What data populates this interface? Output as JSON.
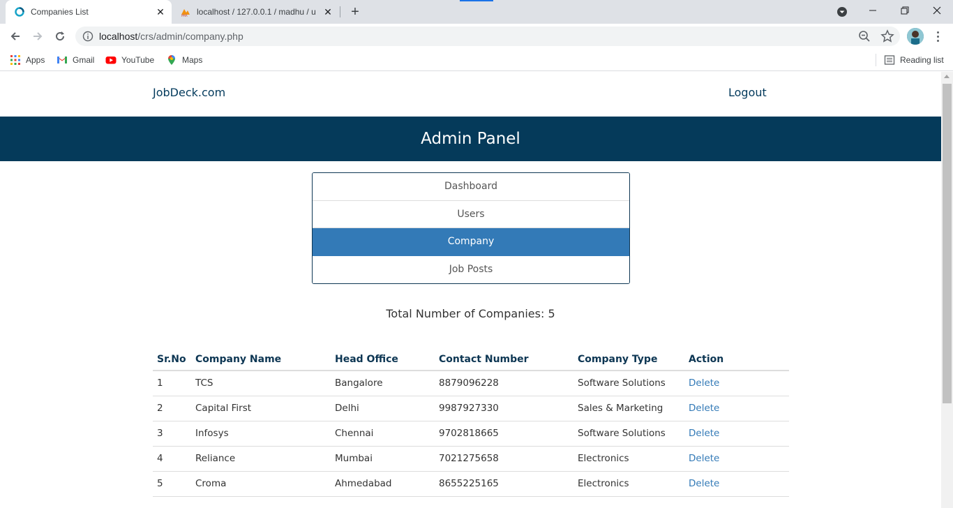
{
  "browser": {
    "tabs": [
      {
        "title": "Companies List",
        "active": true
      },
      {
        "title": "localhost / 127.0.0.1 / madhu / u",
        "active": false
      }
    ],
    "url_host": "localhost",
    "url_path": "/crs/admin/company.php",
    "bookmarks": [
      {
        "label": "Apps",
        "icon": "apps-grid-icon"
      },
      {
        "label": "Gmail",
        "icon": "gmail-icon"
      },
      {
        "label": "YouTube",
        "icon": "youtube-icon"
      },
      {
        "label": "Maps",
        "icon": "maps-icon"
      }
    ],
    "reading_list": "Reading list"
  },
  "header": {
    "brand": "JobDeck.com",
    "logout": "Logout",
    "banner_title": "Admin Panel"
  },
  "menu": {
    "items": [
      {
        "label": "Dashboard",
        "active": false
      },
      {
        "label": "Users",
        "active": false
      },
      {
        "label": "Company",
        "active": true
      },
      {
        "label": "Job Posts",
        "active": false
      }
    ]
  },
  "summary": {
    "total_text": "Total Number of Companies: 5"
  },
  "table": {
    "headers": [
      "Sr.No",
      "Company Name",
      "Head Office",
      "Contact Number",
      "Company Type",
      "Action"
    ],
    "rows": [
      {
        "sr": "1",
        "name": "TCS",
        "office": "Bangalore",
        "contact": "8879096228",
        "type": "Software Solutions",
        "action": "Delete"
      },
      {
        "sr": "2",
        "name": "Capital First",
        "office": "Delhi",
        "contact": "9987927330",
        "type": "Sales & Marketing",
        "action": "Delete"
      },
      {
        "sr": "3",
        "name": "Infosys",
        "office": "Chennai",
        "contact": "9702818665",
        "type": "Software Solutions",
        "action": "Delete"
      },
      {
        "sr": "4",
        "name": "Reliance",
        "office": "Mumbai",
        "contact": "7021275658",
        "type": "Electronics",
        "action": "Delete"
      },
      {
        "sr": "5",
        "name": "Croma",
        "office": "Ahmedabad",
        "contact": "8655225165",
        "type": "Electronics",
        "action": "Delete"
      }
    ]
  },
  "colors": {
    "banner": "#053a5a",
    "accent": "#337ab7",
    "brand_text": "#033a5c"
  }
}
